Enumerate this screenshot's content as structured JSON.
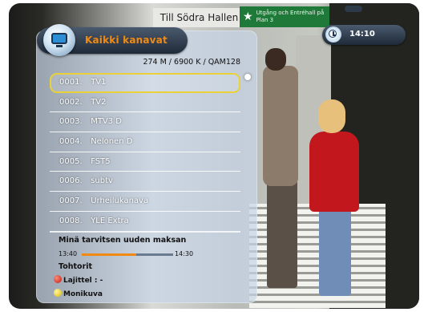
{
  "header": {
    "title": "Kaikki kanavat",
    "transponder_info": "274 M / 6900 K / QAM128",
    "clock": "14:10"
  },
  "channels": [
    {
      "number": "0001.",
      "name": "TV1",
      "selected": true
    },
    {
      "number": "0002.",
      "name": "TV2",
      "selected": false
    },
    {
      "number": "0003.",
      "name": "MTV3 D",
      "selected": false
    },
    {
      "number": "0004.",
      "name": "Nelonen D",
      "selected": false
    },
    {
      "number": "0005.",
      "name": "FST5",
      "selected": false
    },
    {
      "number": "0006.",
      "name": "subtv",
      "selected": false
    },
    {
      "number": "0007.",
      "name": "Urheilukanava",
      "selected": false
    },
    {
      "number": "0008.",
      "name": "YLE Extra",
      "selected": false
    }
  ],
  "epg": {
    "current_program": "Minä tarvitsen uuden maksan",
    "start_time": "13:40",
    "end_time": "14:30",
    "progress_fraction": 0.6,
    "next_program": "Tohtorit"
  },
  "legend": {
    "red_label": "Lajittel : -",
    "yellow_label": "Monikuva"
  },
  "background_scene": {
    "sign_left": "Till Södra Hallen",
    "sign_right": "Utgång och Entréhall på Plan 3"
  },
  "colors": {
    "title_orange": "#f08a12",
    "selection_yellow": "#ead13a",
    "panel_blue": "#c8d6e8"
  }
}
